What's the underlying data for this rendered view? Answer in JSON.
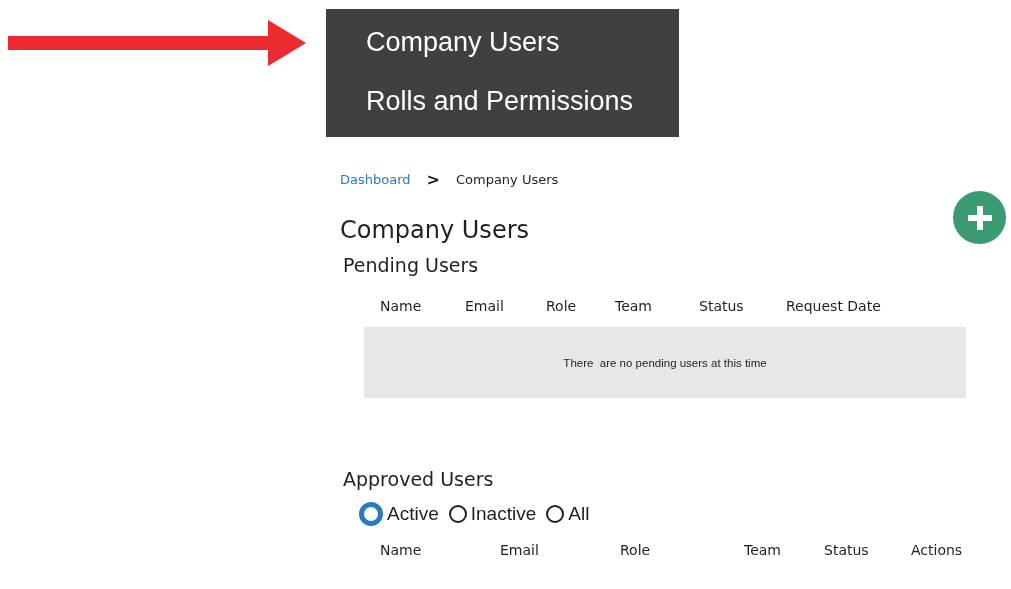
{
  "menu": {
    "items": [
      {
        "label": "Company Users"
      },
      {
        "label": "Rolls and Permissions"
      }
    ]
  },
  "breadcrumb": [
    {
      "label": "Dashboard",
      "kind": "link"
    },
    {
      "label": ">",
      "kind": "separator"
    },
    {
      "label": "Company Users",
      "kind": "current"
    }
  ],
  "title": "Company Users",
  "pending": {
    "title": "Pending Users",
    "columns": [
      "Name",
      "Email",
      "Role",
      "Team",
      "Status",
      "Request Date"
    ],
    "empty_message": "There  are no pending users at this time"
  },
  "approved": {
    "title": "Approved Users",
    "filters": [
      {
        "label": "Active",
        "selected": true
      },
      {
        "label": "Inactive",
        "selected": false
      },
      {
        "label": "All",
        "selected": false
      }
    ],
    "columns": [
      "Name",
      "Email",
      "Role",
      "Team",
      "Status",
      "Actions"
    ]
  }
}
